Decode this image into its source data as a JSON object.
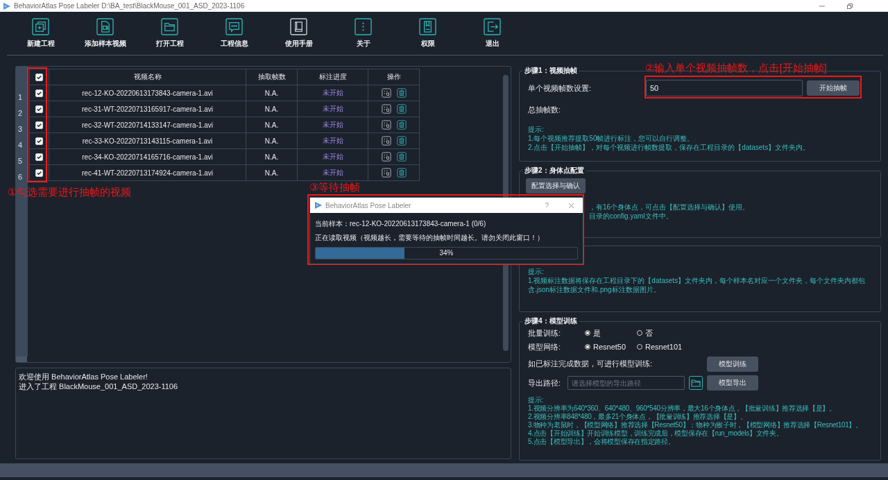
{
  "window": {
    "title": "BehaviorAtlas Pose Labeler  D:\\BA_test\\BlackMouse_001_ASD_2023-1106"
  },
  "toolbar": [
    {
      "label": "新建工程"
    },
    {
      "label": "添加样本视频"
    },
    {
      "label": "打开工程"
    },
    {
      "label": "工程信息"
    },
    {
      "label": "使用手册"
    },
    {
      "label": "关于"
    },
    {
      "label": "权限"
    },
    {
      "label": "退出"
    }
  ],
  "table": {
    "all_checked": true,
    "columns": [
      "视频名称",
      "抽取帧数",
      "标注进度",
      "操作"
    ],
    "rows": [
      {
        "index": "1",
        "checked": true,
        "name": "rec-12-KO-20220613173843-camera-1.avi",
        "frames": "N.A.",
        "status": "未开始"
      },
      {
        "index": "2",
        "checked": true,
        "name": "rec-31-WT-20220713165917-camera-1.avi",
        "frames": "N.A.",
        "status": "未开始"
      },
      {
        "index": "3",
        "checked": true,
        "name": "rec-32-WT-20220714133147-camera-1.avi",
        "frames": "N.A.",
        "status": "未开始"
      },
      {
        "index": "4",
        "checked": true,
        "name": "rec-33-KO-20220713143115-camera-1.avi",
        "frames": "N.A.",
        "status": "未开始"
      },
      {
        "index": "5",
        "checked": true,
        "name": "rec-34-KO-20220714165716-camera-1.avi",
        "frames": "N.A.",
        "status": "未开始"
      },
      {
        "index": "6",
        "checked": true,
        "name": "rec-41-WT-20220713174924-camera-1.avi",
        "frames": "N.A.",
        "status": "未开始"
      }
    ]
  },
  "log": [
    "欢迎使用 BehaviorAtlas Pose Labeler!",
    "进入了工程 BlackMouse_001_ASD_2023-1106"
  ],
  "step1": {
    "title": "步骤1：视频抽帧",
    "frames_label": "单个视频帧数设置:",
    "frames_value": "50",
    "button": "开始抽帧",
    "total_label": "总抽帧数:",
    "hints": [
      "提示:",
      "1.每个视频推荐提取50帧进行标注，您可以自行调整。",
      "2.点击【开始抽帧】，对每个视频进行帧数提取，保存在工程目录的【datasets】文件夹内。"
    ]
  },
  "step2": {
    "title": "步骤2：身体点配置",
    "button": "配置选择与确认",
    "hints": [
      "，有16个身体点，可点击【配置选择与确认】使用。",
      "目录的config.yaml文件中。"
    ]
  },
  "step3": {
    "hints": [
      "提示:",
      "1.视频标注数据将保存在工程目录下的【datasets】文件夹内，每个样本名对应一个文件夹，每个文件夹内都包含.json标注数据文件和.png标注数据图片。"
    ]
  },
  "step4": {
    "title": "步骤4：模型训练",
    "batch_label": "批量训练:",
    "batch_options": [
      {
        "label": "是",
        "selected": true
      },
      {
        "label": "否",
        "selected": false
      }
    ],
    "network_label": "模型网络:",
    "network_options": [
      {
        "label": "Resnet50",
        "selected": true
      },
      {
        "label": "Resnet101",
        "selected": false
      }
    ],
    "train_label": "如已标注完成数据，可进行模型训练:",
    "train_button": "模型训练",
    "export_label": "导出路径:",
    "export_placeholder": "请选择模型的导出路径",
    "export_button": "模型导出",
    "hints": [
      "提示:",
      "1.视频分辨率为640*360、640*480、960*540分辨率，最大16个身体点，【批量训练】推荐选择【是】。",
      "2.视频分辨率848*480，最多21个身体点，【批量训练】推荐选择【是】。",
      "3.物种为老鼠时，【模型网络】推荐选择【Resnet50】；物种为猴子时，【模型网络】推荐选择【Resnet101】。",
      "4.点击【开始训练】开始训练模型，训练完成后，模型保存在【run_models】文件夹。",
      "5.点击【模型导出】，会将模型保存在指定路径。"
    ]
  },
  "dialog": {
    "title": "BehaviorAtlas Pose Labeler",
    "help": "?",
    "sample": "当前样本：rec-12-KO-20220613173843-camera-1 (0/6)",
    "message": "正在读取视频（视频越长，需要等待的抽帧时间越长。请勿关闭此窗口！）",
    "level": 0.34,
    "percent": "34%"
  },
  "annotations": [
    {
      "text": "①勾选需要进行抽帧的视频"
    },
    {
      "text": "②输入单个视频抽帧数，点击[开始抽帧]"
    },
    {
      "text": "③等待抽帧"
    }
  ]
}
